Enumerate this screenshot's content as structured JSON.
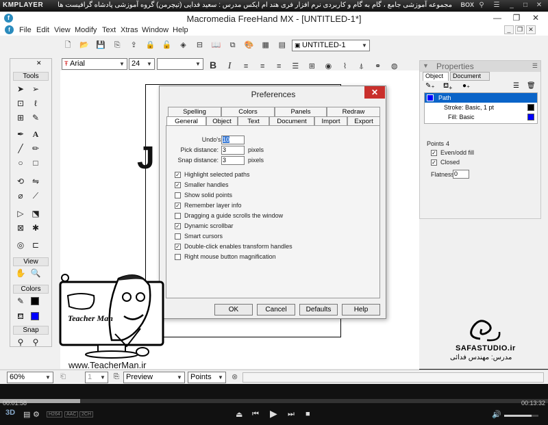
{
  "player": {
    "logo": "KMPLAYER",
    "title": "مجموعه آموزشی جامع ، گام به گام و کاربردی نرم افزار فری هند ام ایکس    مدرس : سعید فدایی (تیچرمن) گروه آموزشی پادشاه گرافیست ها",
    "box_label": "BOX",
    "time_elapsed": "00:01:58",
    "time_total": "00:13:32",
    "progress_fraction": 0.146,
    "volume_fraction": 0.8,
    "badges": [
      "H264",
      "AAC",
      "2CH"
    ]
  },
  "app": {
    "title": "Macromedia FreeHand MX - [UNTITLED-1*]",
    "menus": [
      "File",
      "Edit",
      "View",
      "Modify",
      "Text",
      "Xtras",
      "Window",
      "Help"
    ],
    "document_combo": "UNTITLED-1",
    "font_combo": "Arial",
    "size_combo": "24",
    "style_combo": "",
    "canvas_text": "J"
  },
  "tools_panel": {
    "sections": [
      "Tools",
      "View",
      "Colors",
      "Snap"
    ],
    "colors": {
      "stroke": "#000000",
      "fill": "#0000ff"
    }
  },
  "properties": {
    "title": "Properties",
    "tabs": [
      "Object",
      "Document"
    ],
    "list": {
      "path": "Path",
      "stroke": "Stroke: Basic, 1 pt",
      "fill": "Fill: Basic",
      "stroke_color": "#000000",
      "fill_color": "#0000ff"
    },
    "points_label": "Points",
    "points_value": "4",
    "evenodd_label": "Even/odd fill",
    "closed_label": "Closed",
    "flatness_label": "Flatness:",
    "flatness_value": "0"
  },
  "prefs": {
    "title": "Preferences",
    "tabs_top": [
      "Spelling",
      "Colors",
      "Panels",
      "Redraw"
    ],
    "tabs_bottom": [
      "General",
      "Object",
      "Text",
      "Document",
      "Import",
      "Export"
    ],
    "undos_label": "Undo's:",
    "undos_value": "10",
    "pick_label": "Pick distance:",
    "pick_value": "3",
    "snap_label": "Snap distance:",
    "snap_value": "3",
    "pixels": "pixels",
    "options": [
      {
        "label": "Highlight selected paths",
        "checked": true
      },
      {
        "label": "Smaller handles",
        "checked": true
      },
      {
        "label": "Show solid points",
        "checked": false
      },
      {
        "label": "Remember layer info",
        "checked": true
      },
      {
        "label": "Dragging a guide scrolls the window",
        "checked": false
      },
      {
        "label": "Dynamic scrollbar",
        "checked": true
      },
      {
        "label": "Smart cursors",
        "checked": false
      },
      {
        "label": "Double-click enables transform handles",
        "checked": true
      },
      {
        "label": "Right mouse button magnification",
        "checked": false
      }
    ],
    "buttons": {
      "ok": "OK",
      "cancel": "Cancel",
      "defaults": "Defaults",
      "help": "Help"
    }
  },
  "status": {
    "zoom": "60%",
    "page": "1",
    "mode": "Preview",
    "units": "Points"
  },
  "watermark": {
    "teacher_brand": "Teacher Man",
    "teacher_url": "www.TeacherMan.ir",
    "safa_brand": "SAFASTUDIO.ir",
    "safa_sub": "مدرس: مهندس فدائی"
  }
}
